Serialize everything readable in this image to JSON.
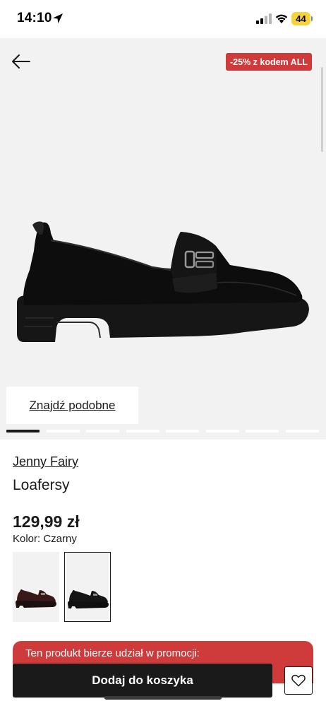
{
  "status_bar": {
    "time": "14:10",
    "battery": "44"
  },
  "gallery": {
    "promo_badge": "-25% z kodem ALL",
    "find_similar": "Znajdź podobne",
    "dots_count": 8,
    "active_dot": 0
  },
  "product": {
    "brand": "Jenny Fairy",
    "name": "Loafersy",
    "price": "129,99 zł",
    "color_label": "Kolor: Czarny"
  },
  "color_swatches": [
    {
      "color": "burgundy",
      "selected": false
    },
    {
      "color": "black",
      "selected": true
    }
  ],
  "promo_banner": {
    "text": "Ten produkt bierze udział w promocji:"
  },
  "actions": {
    "add_to_cart": "Dodaj do koszyka"
  },
  "icons": {
    "back": "arrow-left-icon",
    "wishlist": "heart-icon",
    "location": "location-arrow-icon",
    "signal": "cellular-signal-icon",
    "wifi": "wifi-icon"
  }
}
